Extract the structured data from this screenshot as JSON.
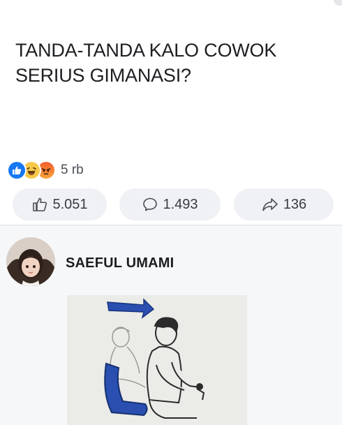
{
  "post": {
    "text": "TANDA-TANDA KALO COWOK\nSERIUS GIMANASI?",
    "reactions": {
      "types": [
        "like-icon",
        "haha-icon",
        "angry-icon"
      ],
      "count": "5 rb"
    },
    "actions": {
      "like_count": "5.051",
      "comment_count": "1.493",
      "share_count": "136"
    }
  },
  "comment": {
    "author": "SAEFUL UMAMI",
    "attachment_icon": "sketch-image"
  },
  "colors": {
    "like_blue": "#1877f2",
    "pill_bg": "#eff1f4",
    "comment_bg": "#f6f7f9",
    "sketch_blue": "#2a4fb0"
  }
}
